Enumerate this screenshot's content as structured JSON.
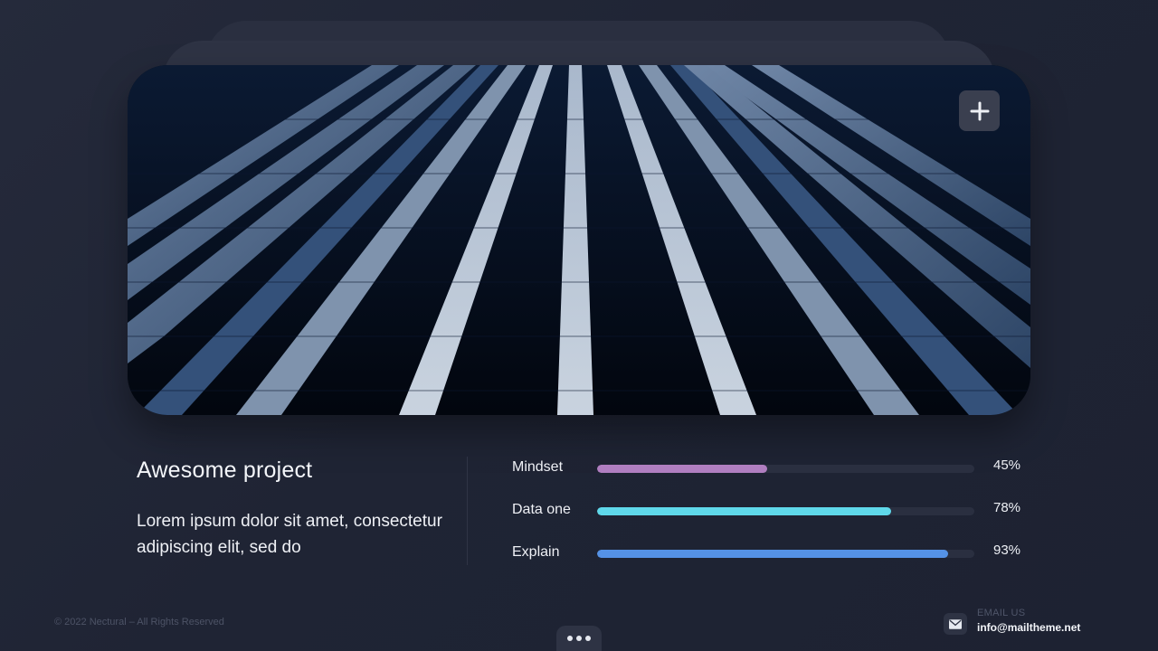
{
  "hero": {
    "add_icon": "plus-icon"
  },
  "project": {
    "title": "Awesome project",
    "description": "Lorem ipsum dolor sit amet, consectetur adipiscing elit, sed do"
  },
  "skills": [
    {
      "label": "Mindset",
      "value": "45%",
      "percent": 0.45,
      "color": "#b07ec0"
    },
    {
      "label": "Data one",
      "value": "78%",
      "percent": 0.78,
      "color": "#5fd8ea"
    },
    {
      "label": "Explain",
      "value": "93%",
      "percent": 0.93,
      "color": "#5592e6"
    }
  ],
  "footer": {
    "copyright": "© 2022 Nectural – All Rights Reserved",
    "email_label": "EMAIL US",
    "email": "info@mailtheme.net",
    "more_icon": "more-dots-icon",
    "mail_icon": "envelope-icon"
  }
}
